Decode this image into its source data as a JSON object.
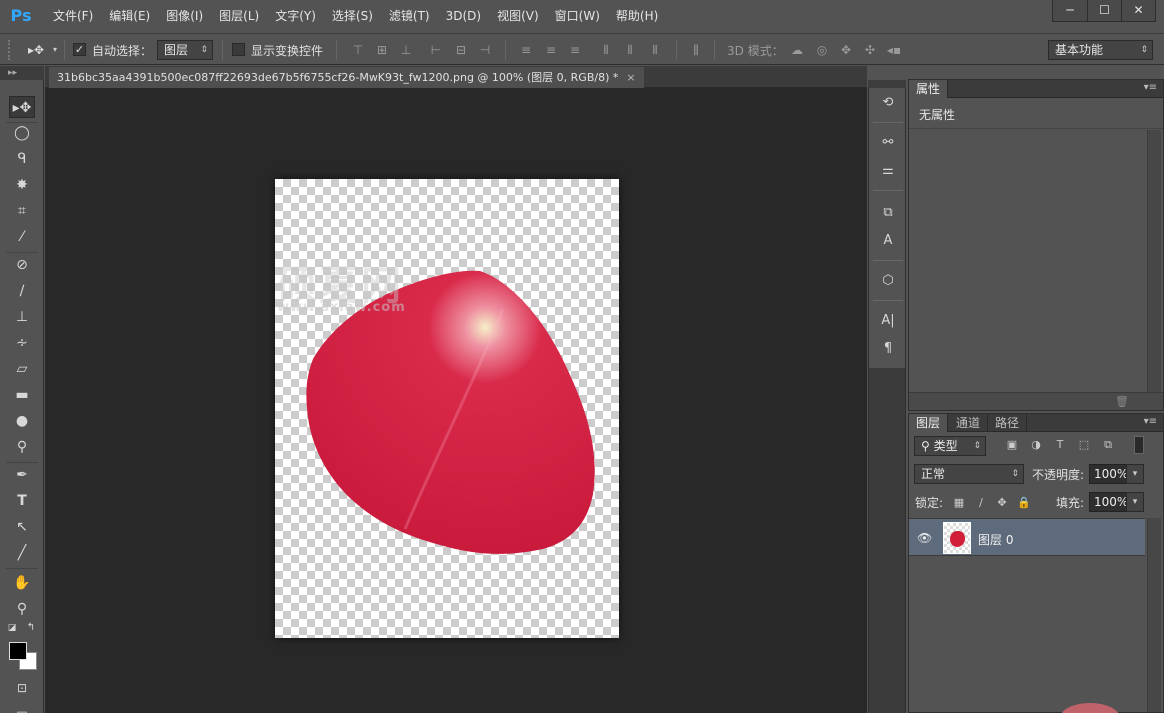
{
  "app": {
    "logo": "Ps"
  },
  "menu": [
    "文件(F)",
    "编辑(E)",
    "图像(I)",
    "图层(L)",
    "文字(Y)",
    "选择(S)",
    "滤镜(T)",
    "3D(D)",
    "视图(V)",
    "窗口(W)",
    "帮助(H)"
  ],
  "window_controls": {
    "minimize": "─",
    "maximize": "☐",
    "close": "✕"
  },
  "options_bar": {
    "auto_select_label": "自动选择：",
    "auto_select_checked": "✓",
    "auto_select_target": "图层",
    "show_transform_label": "显示变换控件",
    "mode_3d_label": "3D 模式：",
    "workspace": "基本功能"
  },
  "document": {
    "tab_title": "31b6bc35aa4391b500ec087ff22693de67b5f6755cf26-MwK93t_fw1200.png @ 100% (图层 0, RGB/8) *",
    "close_glyph": "×"
  },
  "watermark": {
    "text": "硕夏网",
    "url": "www.sxiaw.com"
  },
  "properties_panel": {
    "tab": "属性",
    "content": "无属性"
  },
  "layers_panel": {
    "tabs": [
      "图层",
      "通道",
      "路径"
    ],
    "filter_kind": "类型",
    "blend_mode": "正常",
    "opacity_label": "不透明度:",
    "opacity_value": "100%",
    "lock_label": "锁定:",
    "fill_label": "填充:",
    "fill_value": "100%",
    "layers": [
      {
        "name": "图层 0",
        "visible": true
      }
    ]
  },
  "colors": {
    "foreground": "#000000",
    "background": "#ffffff",
    "petal": "#d31c3c",
    "selected_layer": "#5e6b7c"
  },
  "icons": {
    "tools": [
      "move-icon",
      "elliptical-marquee-icon",
      "lasso-icon",
      "magic-wand-icon",
      "crop-icon",
      "eyedropper-icon",
      "spot-healing-icon",
      "brush-icon",
      "clone-stamp-icon",
      "history-brush-icon",
      "eraser-icon",
      "gradient-icon",
      "blur-icon",
      "dodge-icon",
      "pen-icon",
      "type-icon",
      "path-selection-icon",
      "line-icon",
      "hand-icon",
      "zoom-icon"
    ],
    "dock": [
      "history-icon",
      "actions-icon",
      "adjustments-icon",
      "paragraph-styles-icon",
      "character-styles-icon",
      "3d-icon",
      "character-icon",
      "paragraph-icon"
    ]
  }
}
